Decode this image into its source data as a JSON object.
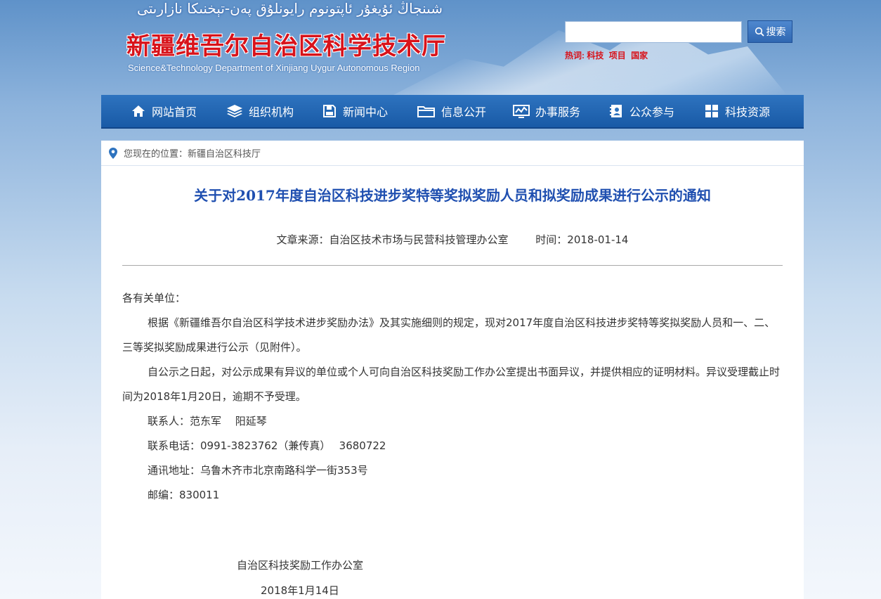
{
  "header": {
    "uyghur_title": "شىنجاڭ ئۇيغۇر ئاپتونوم رايونلۇق پەن-تېخنىكا نازارىتى",
    "title": "新疆维吾尔自治区科学技术厅",
    "subtitle": "Science&Technology Department of Xinjiang Uygur Autonomous Region",
    "search": {
      "placeholder": "",
      "button_label": "搜索"
    },
    "hot_label": "热词:",
    "hot_words": [
      "科技",
      "项目",
      "国家"
    ]
  },
  "nav": {
    "items": [
      {
        "label": "网站首页",
        "icon": "home-icon"
      },
      {
        "label": "组织机构",
        "icon": "layers-icon"
      },
      {
        "label": "新闻中心",
        "icon": "save-icon"
      },
      {
        "label": "信息公开",
        "icon": "folder-icon"
      },
      {
        "label": "办事服务",
        "icon": "chart-icon"
      },
      {
        "label": "公众参与",
        "icon": "contacts-icon"
      },
      {
        "label": "科技资源",
        "icon": "grid-icon"
      }
    ]
  },
  "breadcrumb": {
    "text": "您现在的位置：新疆自治区科技厅"
  },
  "article": {
    "title": "关于对2017年度自治区科技进步奖特等奖拟奖励人员和拟奖励成果进行公示的通知",
    "source": "文章来源：自治区技术市场与民营科技管理办公室",
    "time": "时间：2018-01-14",
    "salutation": "各有关单位：",
    "paragraph1": "根据《新疆维吾尔自治区科学技术进步奖励办法》及其实施细则的规定，现对2017年度自治区科技进步奖特等奖拟奖励人员和一、二、三等奖拟奖励成果进行公示（见附件）。",
    "paragraph2": "自公示之日起，对公示成果有异议的单位或个人可向自治区科技奖励工作办公室提出书面异议，并提供相应的证明材料。异议受理截止时间为2018年1月20日，逾期不予受理。",
    "contact": "联系人：范东军　 阳延琴",
    "phone": "联系电话：0991-3823762（兼传真）　 3680722",
    "address": "通讯地址：乌鲁木齐市北京南路科学一街353号",
    "postcode": "邮编：830011",
    "signature_office": "自治区科技奖励工作办公室",
    "signature_date": "2018年1月14日"
  },
  "colors": {
    "nav_bg": "#2e73bf",
    "title_red": "#d8131b",
    "article_title": "#1f4fb0"
  }
}
